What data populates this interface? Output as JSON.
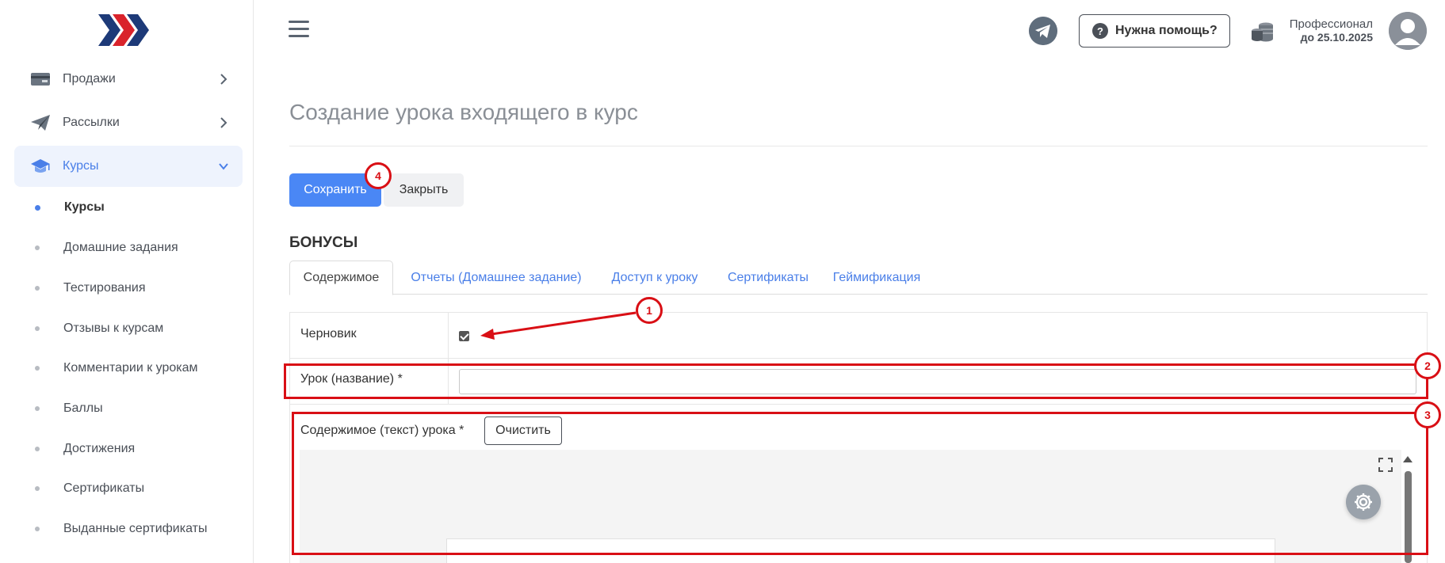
{
  "sidebar": {
    "items": [
      {
        "label": "Продажи",
        "icon": "wallet-icon"
      },
      {
        "label": "Рассылки",
        "icon": "paper-plane-icon"
      },
      {
        "label": "Курсы",
        "icon": "graduation-cap-icon"
      }
    ],
    "sub_items": [
      {
        "label": "Курсы"
      },
      {
        "label": "Домашние задания"
      },
      {
        "label": "Тестирования"
      },
      {
        "label": "Отзывы к курсам"
      },
      {
        "label": "Комментарии к урокам"
      },
      {
        "label": "Баллы"
      },
      {
        "label": "Достижения"
      },
      {
        "label": "Сертификаты"
      },
      {
        "label": "Выданные сертификаты"
      }
    ]
  },
  "header": {
    "help_label": "Нужна помощь?",
    "help_q": "?",
    "plan_name": "Профессионал",
    "plan_date": "до 25.10.2025"
  },
  "main": {
    "title": "Создание урока входящего в курс",
    "save_label": "Сохранить",
    "close_label": "Закрыть",
    "section_heading": "БОНУСЫ",
    "tabs": [
      {
        "label": "Содержимое"
      },
      {
        "label": "Отчеты (Домашнее задание)"
      },
      {
        "label": "Доступ к уроку"
      },
      {
        "label": "Сертификаты"
      },
      {
        "label": "Геймификация"
      }
    ],
    "form": {
      "draft_label": "Черновик",
      "draft_checked": true,
      "lesson_name_label": "Урок (название) *",
      "lesson_name_value": "",
      "content_label": "Содержимое (текст) урока *",
      "clear_label": "Очистить"
    }
  },
  "annotations": [
    "1",
    "2",
    "3",
    "4"
  ],
  "colors": {
    "accent": "#4a87f5",
    "annotation": "#d90f15",
    "logo_dark": "#1d3a78",
    "logo_red": "#d9232b"
  }
}
